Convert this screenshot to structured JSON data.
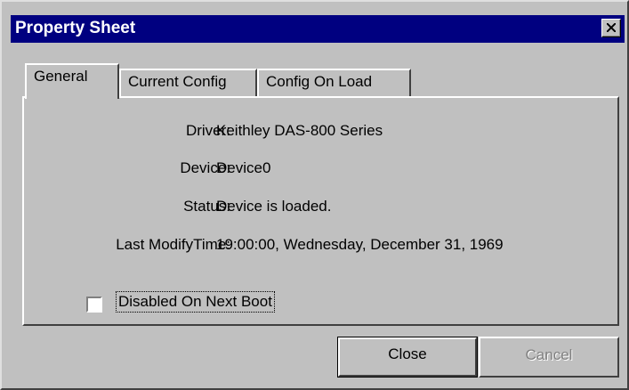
{
  "window": {
    "title": "Property Sheet"
  },
  "tabs": [
    {
      "label": "General",
      "active": true
    },
    {
      "label": "Current Config",
      "active": false
    },
    {
      "label": "Config On Load",
      "active": false
    }
  ],
  "general": {
    "fields": [
      {
        "label": "Driver:",
        "value": "Keithley DAS-800 Series"
      },
      {
        "label": "Device:",
        "value": "Device0"
      },
      {
        "label": "Status:",
        "value": "Device is loaded."
      },
      {
        "label": "Last ModifyTime:",
        "value": "19:00:00, Wednesday, December 31, 1969"
      }
    ],
    "disabled_checkbox": {
      "label": "Disabled On Next Boot",
      "checked": false
    }
  },
  "buttons": {
    "close": "Close",
    "cancel": "Cancel"
  },
  "colors": {
    "titlebar": "#000080",
    "face": "#c0c0c0",
    "disabled_text": "#808080"
  }
}
